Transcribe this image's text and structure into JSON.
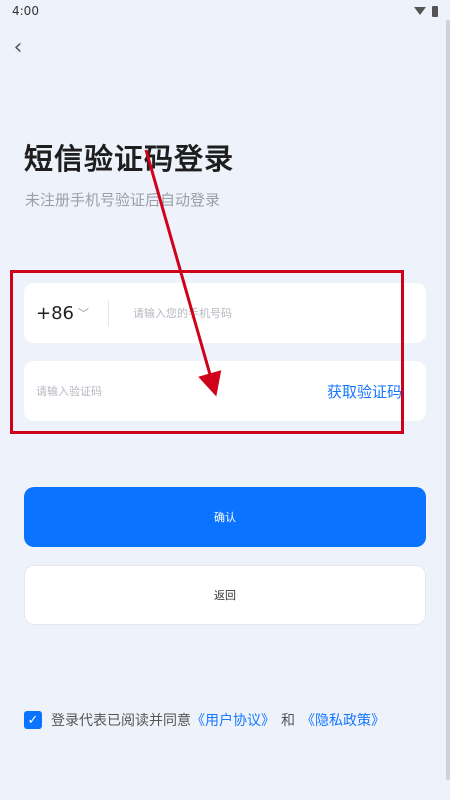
{
  "status_bar": {
    "time": "4:00"
  },
  "header": {
    "back_icon": "chevron-left-icon"
  },
  "page": {
    "title": "短信验证码登录",
    "subtitle": "未注册手机号验证后自动登录"
  },
  "phone": {
    "country_code": "+86",
    "placeholder": "请输入您的手机号码"
  },
  "code": {
    "placeholder": "请输入验证码",
    "get_code_label": "获取验证码"
  },
  "buttons": {
    "confirm_label": "确认",
    "back_label": "返回"
  },
  "agreement": {
    "checked": true,
    "text": "登录代表已阅读并同意",
    "user_agreement": "《用户协议》",
    "and": "和",
    "privacy_policy": "《隐私政策》"
  },
  "colors": {
    "accent": "#0a73ff",
    "link": "#1677ff",
    "annotation": "#d0021b",
    "background": "#eef3fb"
  }
}
